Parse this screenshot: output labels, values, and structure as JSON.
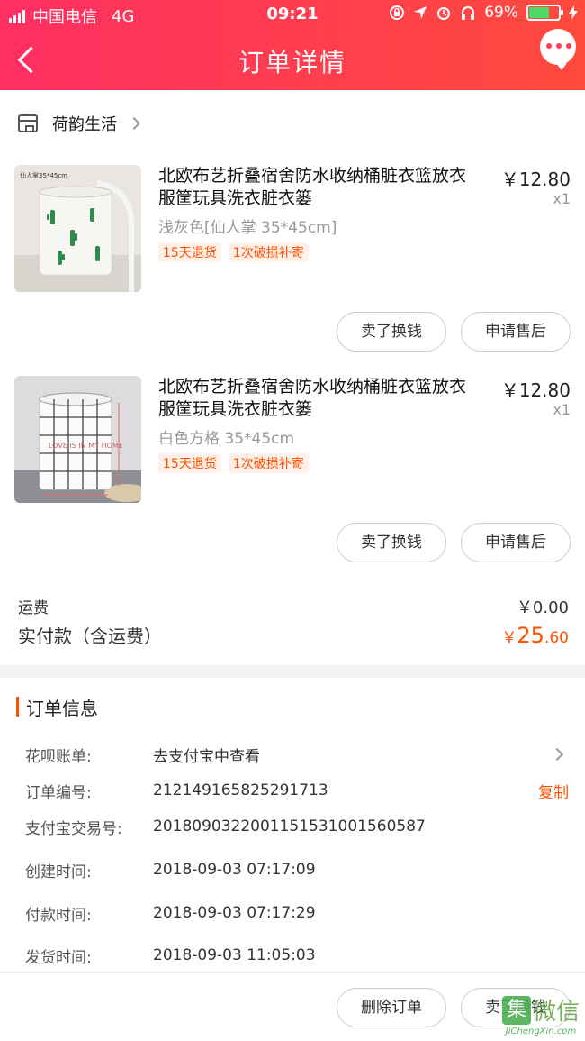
{
  "status_bar": {
    "carrier": "中国电信",
    "network": "4G",
    "time": "09:21",
    "battery_percent": "69%",
    "battery_level": 0.69
  },
  "nav": {
    "title": "订单详情"
  },
  "shop": {
    "name": "荷韵生活"
  },
  "items": [
    {
      "title": "北欧布艺折叠宿舍防水收纳桶脏衣篮放衣服筐玩具洗衣脏衣篓",
      "price": "￥12.80",
      "qty": "x1",
      "sku": "浅灰色[仙人掌 35*45cm]",
      "tags": [
        "15天退货",
        "1次破损补寄"
      ],
      "thumb_label": "仙人掌35*45cm",
      "buttons": [
        "卖了换钱",
        "申请售后"
      ]
    },
    {
      "title": "北欧布艺折叠宿舍防水收纳桶脏衣篮放衣服筐玩具洗衣脏衣篓",
      "price": "￥12.80",
      "qty": "x1",
      "sku": "白色方格 35*45cm",
      "tags": [
        "15天退货",
        "1次破损补寄"
      ],
      "thumb_text": "LOVE IS IN MY HOME",
      "buttons": [
        "卖了换钱",
        "申请售后"
      ]
    }
  ],
  "fees": {
    "shipping_label": "运费",
    "shipping_value": "￥0.00",
    "paid_label": "实付款（含运费）",
    "paid_currency": "￥",
    "paid_int": "25",
    "paid_dec": ".60"
  },
  "order_info": {
    "title": "订单信息",
    "rows": [
      {
        "label": "花呗账单:",
        "value": "去支付宝中查看"
      },
      {
        "label": "订单编号:",
        "value": "212149165825291713",
        "action": "复制"
      },
      {
        "label": "支付宝交易号:",
        "value": "2018090322001151531001560587"
      },
      {
        "label": "创建时间:",
        "value": "2018-09-03 07:17:09"
      },
      {
        "label": "付款时间:",
        "value": "2018-09-03 07:17:29"
      },
      {
        "label": "发货时间:",
        "value": "2018-09-03 11:05:03"
      }
    ]
  },
  "footer": {
    "buttons": [
      "删除订单",
      "卖了换钱"
    ]
  },
  "watermark": {
    "logo": "集",
    "text": "微信",
    "url": "JiChengXin.com"
  },
  "colors": {
    "header_start": "#ff2f62",
    "header_end": "#ff4a3d",
    "accent": "#ff5000",
    "tag_bg": "#fff1ea"
  }
}
